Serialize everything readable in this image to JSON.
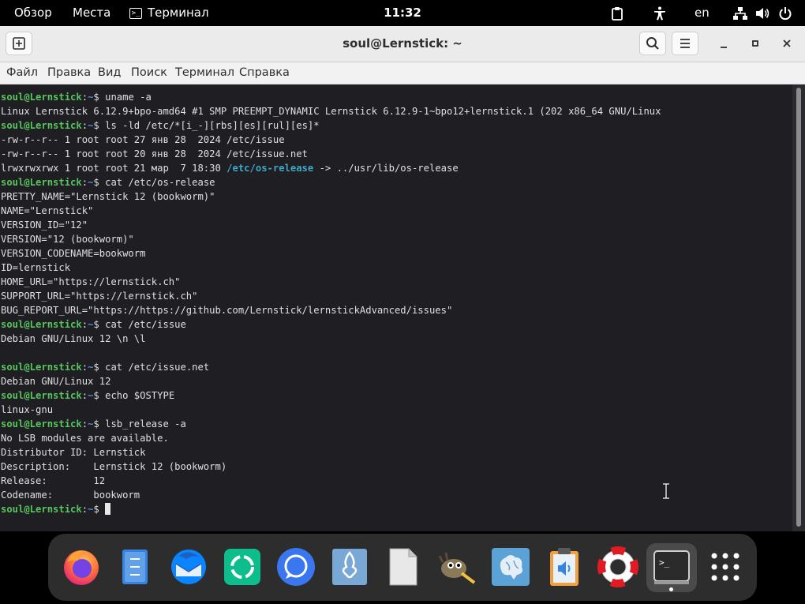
{
  "topbar": {
    "activities": "Обзор",
    "places": "Места",
    "app_menu": "Терминал",
    "clock": "11:32",
    "language": "en"
  },
  "window": {
    "title": "soul@Lernstick: ~",
    "menu": [
      "Файл",
      "Правка",
      "Вид",
      "Поиск",
      "Терминал",
      "Справка"
    ]
  },
  "terminal": {
    "lines": [
      {
        "prompt": true,
        "user": "soul@Lernstick",
        "path": "~",
        "cmd": "uname -a"
      },
      {
        "text": "Linux Lernstick 6.12.9+bpo-amd64 #1 SMP PREEMPT_DYNAMIC Lernstick 6.12.9-1~bpo12+lernstick.1 (202 x86_64 GNU/Linux"
      },
      {
        "prompt": true,
        "user": "soul@Lernstick",
        "path": "~",
        "cmd": "ls -ld /etc/*[i_-][rbs][es][rul][es]*"
      },
      {
        "text": "-rw-r--r-- 1 root root 27 янв 28  2024 /etc/issue"
      },
      {
        "text": "-rw-r--r-- 1 root root 20 янв 28  2024 /etc/issue.net"
      },
      {
        "link": true,
        "pre": "lrwxrwxrwx 1 root root 21 мар  7 18:30 ",
        "link_name": "/etc/os-release",
        "post": " -> ../usr/lib/os-release"
      },
      {
        "prompt": true,
        "user": "soul@Lernstick",
        "path": "~",
        "cmd": "cat /etc/os-release"
      },
      {
        "text": "PRETTY_NAME=\"Lernstick 12 (bookworm)\""
      },
      {
        "text": "NAME=\"Lernstick\""
      },
      {
        "text": "VERSION_ID=\"12\""
      },
      {
        "text": "VERSION=\"12 (bookworm)\""
      },
      {
        "text": "VERSION_CODENAME=bookworm"
      },
      {
        "text": "ID=lernstick"
      },
      {
        "text": "HOME_URL=\"https://lernstick.ch\""
      },
      {
        "text": "SUPPORT_URL=\"https://lernstick.ch\""
      },
      {
        "text": "BUG_REPORT_URL=\"https://https://github.com/Lernstick/lernstickAdvanced/issues\""
      },
      {
        "prompt": true,
        "user": "soul@Lernstick",
        "path": "~",
        "cmd": "cat /etc/issue"
      },
      {
        "text": "Debian GNU/Linux 12 \\n \\l"
      },
      {
        "text": ""
      },
      {
        "prompt": true,
        "user": "soul@Lernstick",
        "path": "~",
        "cmd": "cat /etc/issue.net"
      },
      {
        "text": "Debian GNU/Linux 12"
      },
      {
        "prompt": true,
        "user": "soul@Lernstick",
        "path": "~",
        "cmd": "echo $OSTYPE"
      },
      {
        "text": "linux-gnu"
      },
      {
        "prompt": true,
        "user": "soul@Lernstick",
        "path": "~",
        "cmd": "lsb_release -a"
      },
      {
        "text": "No LSB modules are available."
      },
      {
        "text": "Distributor ID:\tLernstick"
      },
      {
        "text": "Description:\tLernstick 12 (bookworm)"
      },
      {
        "text": "Release:\t12"
      },
      {
        "text": "Codename:\tbookworm"
      },
      {
        "prompt": true,
        "user": "soul@Lernstick",
        "path": "~",
        "cmd": "",
        "cursor": true
      }
    ]
  },
  "dock": {
    "apps": [
      {
        "name": "firefox-icon",
        "color": "#ff7139"
      },
      {
        "name": "file-manager-icon",
        "color": "#3584e4"
      },
      {
        "name": "thunderbird-icon",
        "color": "#0a84ff"
      },
      {
        "name": "element-icon",
        "color": "#0dbd8b"
      },
      {
        "name": "signal-icon",
        "color": "#3a76f0"
      },
      {
        "name": "inkscape-icon",
        "color": "#79a7d6"
      },
      {
        "name": "document-viewer-icon",
        "color": "#d0d0d0"
      },
      {
        "name": "gimp-icon",
        "color": "#8a7a5a"
      },
      {
        "name": "brain-app-icon",
        "color": "#5ba3d6"
      },
      {
        "name": "audio-clipboard-icon",
        "color": "#f0a040"
      },
      {
        "name": "help-lifebuoy-icon",
        "color": "#e01b24"
      },
      {
        "name": "terminal-icon",
        "color": "#2b2b2b"
      },
      {
        "name": "app-grid-icon",
        "color": "#ffffff"
      }
    ]
  }
}
